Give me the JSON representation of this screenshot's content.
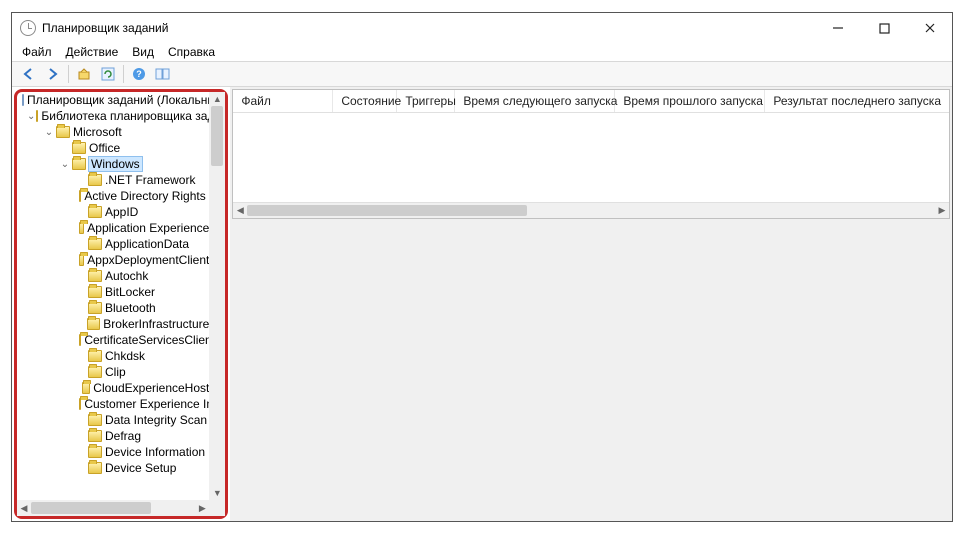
{
  "window": {
    "title": "Планировщик заданий"
  },
  "menu": {
    "file": "Файл",
    "action": "Действие",
    "view": "Вид",
    "help": "Справка"
  },
  "tree": {
    "root": "Планировщик заданий (Локальный)",
    "library": "Библиотека планировщика заданий",
    "microsoft": "Microsoft",
    "office": "Office",
    "windows": "Windows",
    "children": [
      ".NET Framework",
      "Active Directory Rights Management Services",
      "AppID",
      "Application Experience",
      "ApplicationData",
      "AppxDeploymentClient",
      "Autochk",
      "BitLocker",
      "Bluetooth",
      "BrokerInfrastructure",
      "CertificateServicesClient",
      "Chkdsk",
      "Clip",
      "CloudExperienceHost",
      "Customer Experience Improvement Program",
      "Data Integrity Scan",
      "Defrag",
      "Device Information",
      "Device Setup"
    ]
  },
  "columns": {
    "file": "Файл",
    "state": "Состояние",
    "triggers": "Триггеры",
    "next_run": "Время следующего запуска",
    "last_run": "Время прошлого запуска",
    "last_result": "Результат последнего запуска"
  }
}
